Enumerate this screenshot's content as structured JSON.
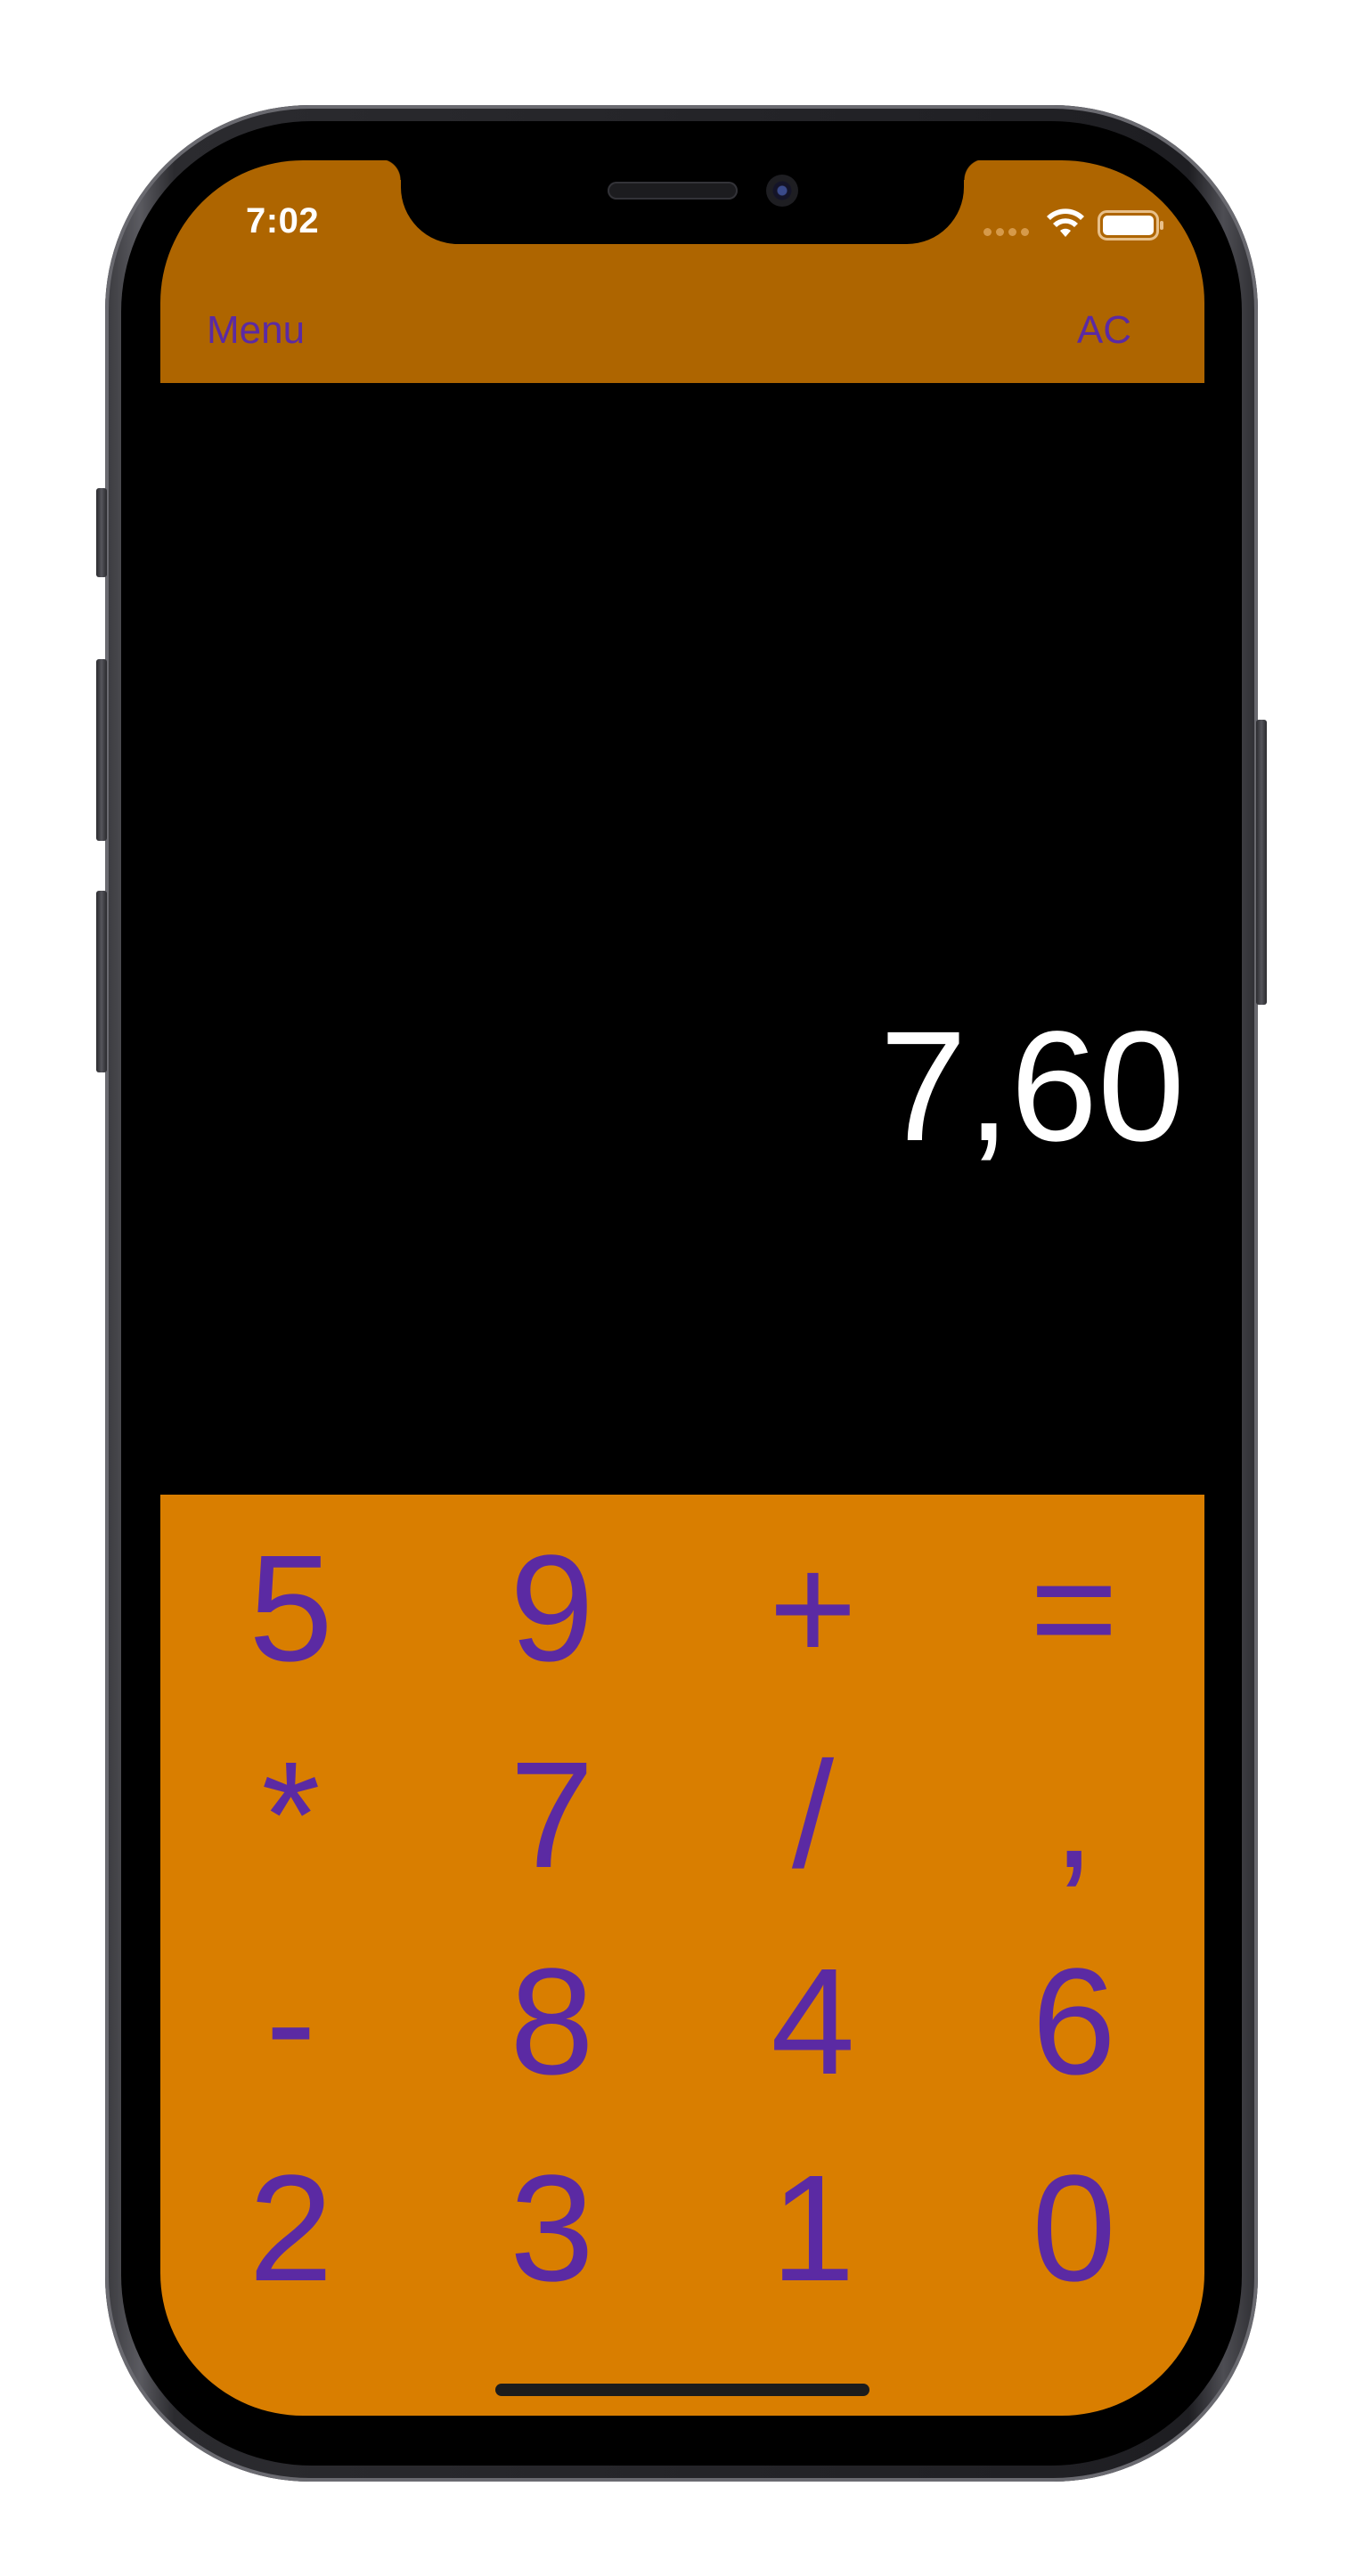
{
  "status_bar": {
    "time": "7:02",
    "icons": [
      "cellular-signal-icon",
      "wifi-icon",
      "battery-icon"
    ]
  },
  "nav": {
    "left_label": "Menu",
    "right_label": "AC"
  },
  "display": {
    "value": "7,60"
  },
  "keypad": {
    "keys": [
      {
        "label": "5",
        "name": "key-5"
      },
      {
        "label": "9",
        "name": "key-9"
      },
      {
        "label": "+",
        "name": "key-plus"
      },
      {
        "label": "=",
        "name": "key-equals"
      },
      {
        "label": "*",
        "name": "key-multiply"
      },
      {
        "label": "7",
        "name": "key-7"
      },
      {
        "label": "/",
        "name": "key-divide"
      },
      {
        "label": ",",
        "name": "key-decimal"
      },
      {
        "label": "-",
        "name": "key-minus"
      },
      {
        "label": "8",
        "name": "key-8"
      },
      {
        "label": "4",
        "name": "key-4"
      },
      {
        "label": "6",
        "name": "key-6"
      },
      {
        "label": "2",
        "name": "key-2"
      },
      {
        "label": "3",
        "name": "key-3"
      },
      {
        "label": "1",
        "name": "key-1"
      },
      {
        "label": "0",
        "name": "key-0"
      }
    ]
  },
  "colors": {
    "nav_bar": "#ae6500",
    "keypad_background": "#d97e00",
    "accent_text": "#5b2aa3",
    "display_background": "#000000",
    "display_text": "#ffffff"
  }
}
